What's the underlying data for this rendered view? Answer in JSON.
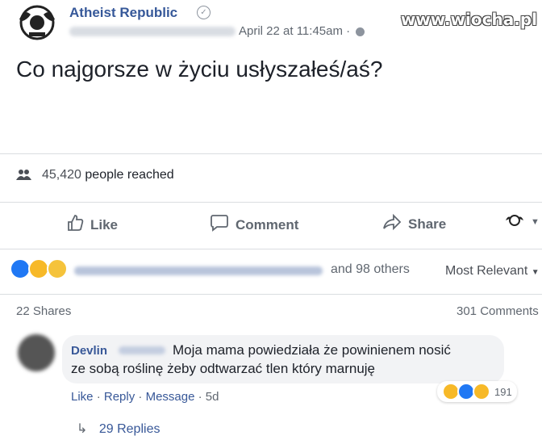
{
  "post": {
    "page_name": "Atheist Republic",
    "date": "April 22 at 11:45am ·",
    "text": "Co najgorsze w życiu usłyszałeś/aś?",
    "reach_count": "45,420",
    "reach_label": "people reached"
  },
  "watermark": "www.wiocha.pl",
  "actions": {
    "like": "Like",
    "comment": "Comment",
    "share": "Share"
  },
  "reactions": {
    "others": "and 98 others",
    "sort": "Most Relevant",
    "shares": "22 Shares",
    "comments": "301 Comments"
  },
  "comment": {
    "author": "Devlin",
    "line1": "Moja mama powiedziała że powinienem nosić",
    "line2": "ze sobą roślinę żeby odtwarzać tlen który marnuję",
    "reaction_count": "191",
    "like": "Like",
    "reply": "Reply",
    "message": "Message",
    "age": "5d",
    "replies": "29 Replies"
  },
  "colors": {
    "link": "#365899",
    "muted": "#606770",
    "bubble": "#f2f3f5"
  }
}
